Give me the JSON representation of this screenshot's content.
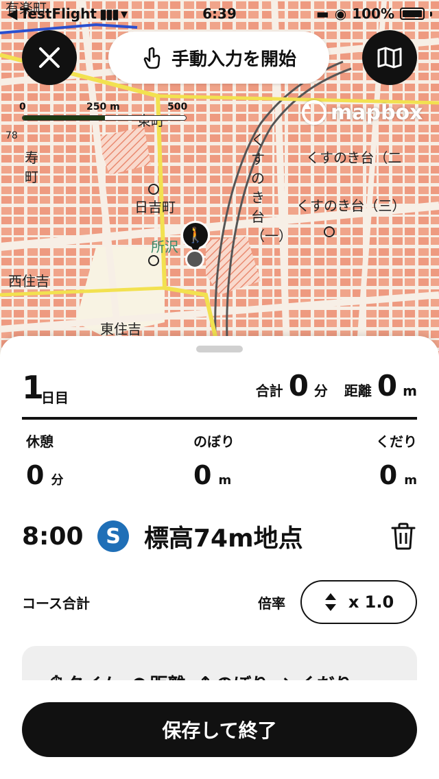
{
  "status_bar": {
    "back_app": "TestFlight",
    "time": "6:39",
    "battery": "100%"
  },
  "top_controls": {
    "manual_label": "手動入力を開始"
  },
  "map": {
    "scale": {
      "l0": "0",
      "l1": "250 m",
      "l2": "500 m"
    },
    "mapbox_label": "mapbox",
    "labels": {
      "kotobuki": "寿",
      "machi": "町",
      "higashicho": "東町",
      "hiyoshicho": "日吉町",
      "tokorozawa": "所沢",
      "nishisumiyoshi": "西住吉",
      "higashisumiyoshi": "東住吉",
      "kusunokidai2": "くすのき台（二",
      "kusunokidai3": "くすのき台（三）",
      "kusunokidai1": "くすのき台（一）",
      "arimachi": "有楽町",
      "num78": "78"
    }
  },
  "sheet": {
    "day_num": "1",
    "day_unit": "日目",
    "total_label": "合計",
    "total_value": "0",
    "total_unit": "分",
    "distance_label": "距離",
    "distance_value": "0",
    "distance_unit": "m",
    "rest_label": "休憩",
    "rest_value": "0",
    "rest_unit": "分",
    "up_label": "のぼり",
    "up_value": "0",
    "up_unit": "m",
    "down_label": "くだり",
    "down_value": "0",
    "down_unit": "m",
    "point_time": "8:00",
    "point_badge": "S",
    "point_name": "標高74m地点",
    "course_label": "コース合計",
    "rate_label": "倍率",
    "rate_value": "x 1.0",
    "tabs": [
      "タイム",
      "距離",
      "のぼり",
      "くだり"
    ]
  },
  "footer": {
    "save_label": "保存して終了"
  },
  "colors": {
    "accent": "#111111",
    "badge": "#1f6fb7",
    "map_bg": "#f7efe6",
    "map_blocks": "#f0a48a"
  }
}
